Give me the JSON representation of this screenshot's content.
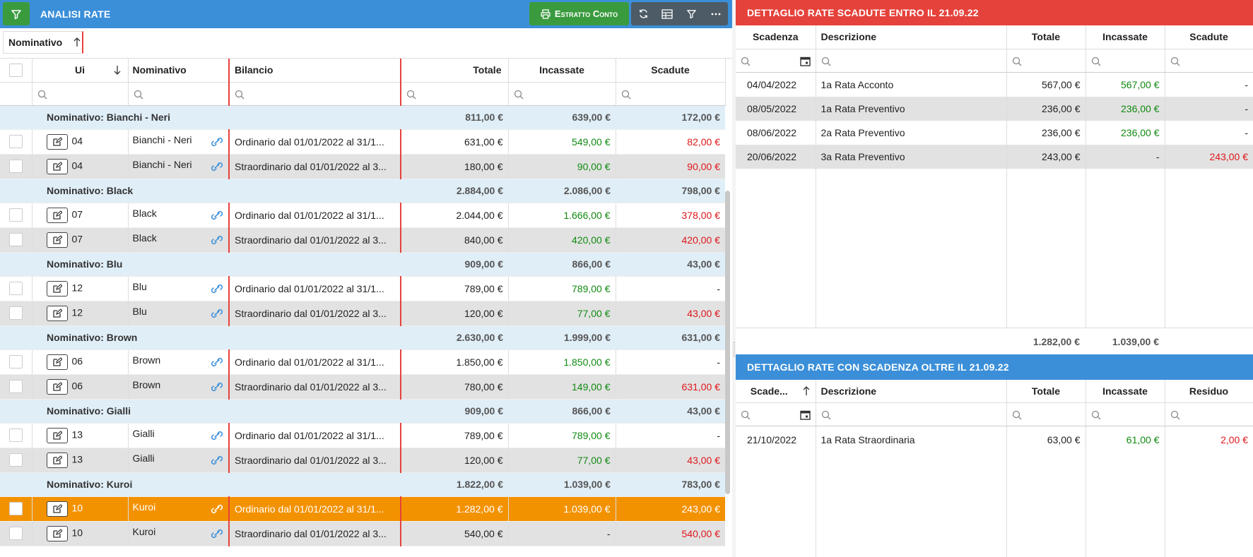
{
  "left": {
    "title": "ANALISI RATE",
    "estratto_label": "Estratto Conto",
    "group_chip": "Nominativo",
    "columns": [
      "Ui",
      "Nominativo",
      "Bilancio",
      "Totale",
      "Incassate",
      "Scadute"
    ],
    "rows": [
      {
        "type": "group",
        "label": "Nominativo: Bianchi - Neri",
        "totale": "811,00 €",
        "incassate": "639,00 €",
        "scadute": "172,00 €"
      },
      {
        "type": "item",
        "ui": "04",
        "nom": "Bianchi - Neri",
        "bil": "Ordinario dal 01/01/2022 al 31/1...",
        "totale": "631,00 €",
        "incassate": "549,00 €",
        "scadute": "82,00 €",
        "inc_color": "green",
        "sca_color": "red"
      },
      {
        "type": "item",
        "alt": true,
        "ui": "04",
        "nom": "Bianchi - Neri",
        "bil": "Straordinario dal 01/01/2022 al 3...",
        "totale": "180,00 €",
        "incassate": "90,00 €",
        "scadute": "90,00 €",
        "inc_color": "green",
        "sca_color": "red"
      },
      {
        "type": "group",
        "label": "Nominativo: Black",
        "totale": "2.884,00 €",
        "incassate": "2.086,00 €",
        "scadute": "798,00 €"
      },
      {
        "type": "item",
        "ui": "07",
        "nom": "Black",
        "bil": "Ordinario dal 01/01/2022 al 31/1...",
        "totale": "2.044,00 €",
        "incassate": "1.666,00 €",
        "scadute": "378,00 €",
        "inc_color": "green",
        "sca_color": "red"
      },
      {
        "type": "item",
        "alt": true,
        "ui": "07",
        "nom": "Black",
        "bil": "Straordinario dal 01/01/2022 al 3...",
        "totale": "840,00 €",
        "incassate": "420,00 €",
        "scadute": "420,00 €",
        "inc_color": "green",
        "sca_color": "red"
      },
      {
        "type": "group",
        "label": "Nominativo: Blu",
        "totale": "909,00 €",
        "incassate": "866,00 €",
        "scadute": "43,00 €"
      },
      {
        "type": "item",
        "ui": "12",
        "nom": "Blu",
        "bil": "Ordinario dal 01/01/2022 al 31/1...",
        "totale": "789,00 €",
        "incassate": "789,00 €",
        "scadute": "-",
        "inc_color": "green",
        "sca_color": ""
      },
      {
        "type": "item",
        "alt": true,
        "ui": "12",
        "nom": "Blu",
        "bil": "Straordinario dal 01/01/2022 al 3...",
        "totale": "120,00 €",
        "incassate": "77,00 €",
        "scadute": "43,00 €",
        "inc_color": "green",
        "sca_color": "red"
      },
      {
        "type": "group",
        "label": "Nominativo: Brown",
        "totale": "2.630,00 €",
        "incassate": "1.999,00 €",
        "scadute": "631,00 €"
      },
      {
        "type": "item",
        "ui": "06",
        "nom": "Brown",
        "bil": "Ordinario dal 01/01/2022 al 31/1...",
        "totale": "1.850,00 €",
        "incassate": "1.850,00 €",
        "scadute": "-",
        "inc_color": "green",
        "sca_color": ""
      },
      {
        "type": "item",
        "alt": true,
        "ui": "06",
        "nom": "Brown",
        "bil": "Straordinario dal 01/01/2022 al 3...",
        "totale": "780,00 €",
        "incassate": "149,00 €",
        "scadute": "631,00 €",
        "inc_color": "green",
        "sca_color": "red"
      },
      {
        "type": "group",
        "label": "Nominativo: Gialli",
        "totale": "909,00 €",
        "incassate": "866,00 €",
        "scadute": "43,00 €"
      },
      {
        "type": "item",
        "ui": "13",
        "nom": "Gialli",
        "bil": "Ordinario dal 01/01/2022 al 31/1...",
        "totale": "789,00 €",
        "incassate": "789,00 €",
        "scadute": "-",
        "inc_color": "green",
        "sca_color": ""
      },
      {
        "type": "item",
        "alt": true,
        "ui": "13",
        "nom": "Gialli",
        "bil": "Straordinario dal 01/01/2022 al 3...",
        "totale": "120,00 €",
        "incassate": "77,00 €",
        "scadute": "43,00 €",
        "inc_color": "green",
        "sca_color": "red"
      },
      {
        "type": "group",
        "label": "Nominativo: Kuroi",
        "totale": "1.822,00 €",
        "incassate": "1.039,00 €",
        "scadute": "783,00 €"
      },
      {
        "type": "item",
        "selected": true,
        "ui": "10",
        "nom": "Kuroi",
        "bil": "Ordinario dal 01/01/2022 al 31/1...",
        "totale": "1.282,00 €",
        "incassate": "1.039,00 €",
        "scadute": "243,00 €",
        "inc_color": "green",
        "sca_color": "red"
      },
      {
        "type": "item",
        "alt": true,
        "ui": "10",
        "nom": "Kuroi",
        "bil": "Straordinario dal 01/01/2022 al 3...",
        "totale": "540,00 €",
        "incassate": "-",
        "scadute": "540,00 €",
        "inc_color": "",
        "sca_color": "red"
      }
    ]
  },
  "scadute": {
    "title": "DETTAGLIO RATE SCADUTE ENTRO IL 21.09.22",
    "columns": [
      "Scadenza",
      "Descrizione",
      "Totale",
      "Incassate",
      "Scadute"
    ],
    "rows": [
      {
        "data": "04/04/2022",
        "desc": "1a Rata Acconto",
        "totale": "567,00 €",
        "incassate": "567,00 €",
        "scadute": "-",
        "inc_color": "green",
        "sca_color": ""
      },
      {
        "data": "08/05/2022",
        "desc": "1a Rata Preventivo",
        "totale": "236,00 €",
        "incassate": "236,00 €",
        "scadute": "-",
        "inc_color": "green",
        "sca_color": "",
        "alt": true
      },
      {
        "data": "08/06/2022",
        "desc": "2a Rata Preventivo",
        "totale": "236,00 €",
        "incassate": "236,00 €",
        "scadute": "-",
        "inc_color": "green",
        "sca_color": ""
      },
      {
        "data": "20/06/2022",
        "desc": "3a Rata Preventivo",
        "totale": "243,00 €",
        "incassate": "-",
        "scadute": "243,00 €",
        "inc_color": "",
        "sca_color": "red",
        "alt": true
      }
    ],
    "tot_totale": "1.282,00 €",
    "tot_incassate": "1.039,00 €"
  },
  "oltre": {
    "title": "DETTAGLIO RATE CON SCADENZA OLTRE IL 21.09.22",
    "columns": [
      "Scade...",
      "Descrizione",
      "Totale",
      "Incassate",
      "Residuo"
    ],
    "rows": [
      {
        "data": "21/10/2022",
        "desc": "1a Rata Straordinaria",
        "totale": "63,00 €",
        "incassate": "61,00 €",
        "residuo": "2,00 €",
        "inc_color": "green",
        "res_color": "red"
      }
    ]
  },
  "colors": {
    "blue": "#3b8fd9",
    "red": "#e5423b",
    "green_btn": "#3a9b3e",
    "selected": "#f39200",
    "group_bg": "#e0eef7"
  }
}
